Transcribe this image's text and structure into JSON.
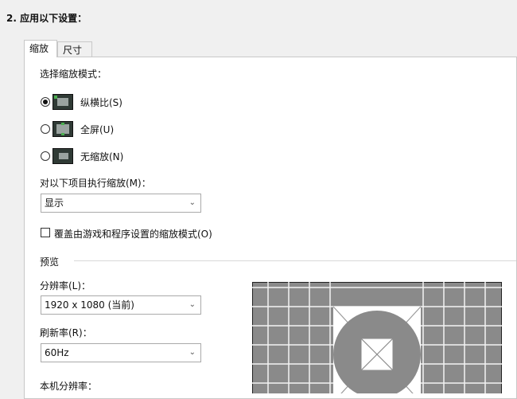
{
  "section_title": "2. 应用以下设置：",
  "tabs": [
    {
      "label": "缩放",
      "active": true
    },
    {
      "label": "尺寸",
      "active": false
    }
  ],
  "scaling_mode": {
    "label": "选择缩放模式：",
    "options": [
      {
        "label": "纵横比(S)",
        "checked": true,
        "icon": "aspect-ratio-icon"
      },
      {
        "label": "全屏(U)",
        "checked": false,
        "icon": "fullscreen-icon"
      },
      {
        "label": "无缩放(N)",
        "checked": false,
        "icon": "no-scaling-icon"
      }
    ]
  },
  "perform_on": {
    "label": "对以下项目执行缩放(M)：",
    "value": "显示"
  },
  "override": {
    "label": "覆盖由游戏和程序设置的缩放模式(O)",
    "checked": false
  },
  "preview": {
    "label": "预览",
    "resolution_label": "分辨率(L)：",
    "resolution_value": "1920 x 1080 (当前)",
    "refresh_label": "刷新率(R)：",
    "refresh_value": "60Hz",
    "native_label": "本机分辨率："
  }
}
